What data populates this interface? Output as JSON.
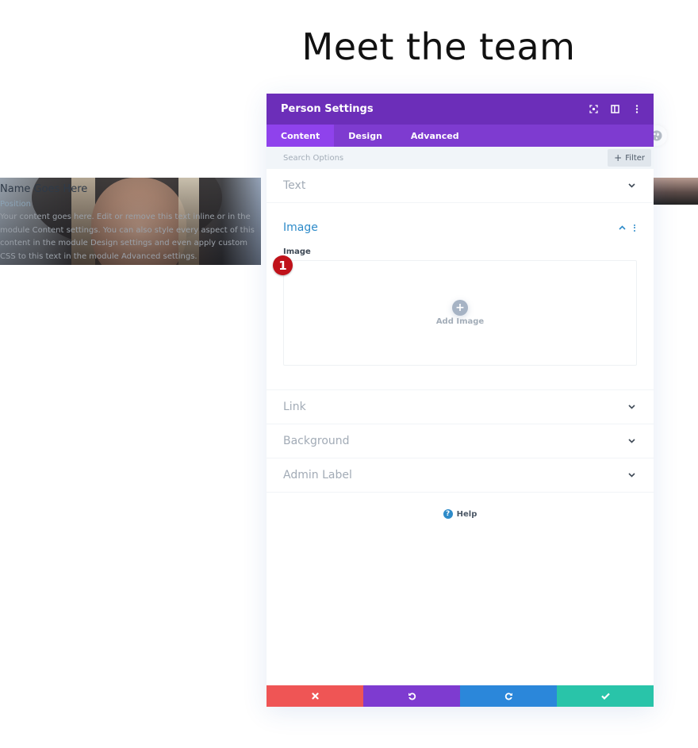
{
  "page": {
    "heading": "Meet the team"
  },
  "person_module": {
    "name": "Name Goes Here",
    "position": "Position",
    "bio": "Your content goes here. Edit or remove this text inline or in the module Content settings. You can also style every aspect of this content in the module Design settings and even apply custom CSS to this text in the module Advanced settings."
  },
  "modal": {
    "title": "Person Settings",
    "header_icons": [
      "focus-icon",
      "split-view-icon",
      "more-options-icon"
    ],
    "tabs": [
      {
        "label": "Content",
        "active": true
      },
      {
        "label": "Design",
        "active": false
      },
      {
        "label": "Advanced",
        "active": false
      }
    ],
    "search": {
      "placeholder": "Search Options",
      "value": ""
    },
    "filter_label": "Filter",
    "sections": [
      {
        "title": "Text",
        "open": false
      },
      {
        "title": "Image",
        "open": true,
        "field_label": "Image",
        "upload_label": "Add Image"
      },
      {
        "title": "Link",
        "open": false
      },
      {
        "title": "Background",
        "open": false
      },
      {
        "title": "Admin Label",
        "open": false
      }
    ],
    "help_label": "Help",
    "footer_buttons": [
      {
        "name": "discard",
        "icon": "close-icon",
        "color": "#ef5555"
      },
      {
        "name": "undo",
        "icon": "undo-icon",
        "color": "#7e3bd0"
      },
      {
        "name": "redo",
        "icon": "redo-icon",
        "color": "#2b87da"
      },
      {
        "name": "save",
        "icon": "check-icon",
        "color": "#29c4a9"
      }
    ]
  },
  "annotation": {
    "step_number": "1",
    "color": "#c0121a"
  },
  "colors": {
    "header_purple": "#6c2eb9",
    "tab_bar_purple": "#7e3bd0",
    "active_tab_purple": "#8f42ec",
    "accent_blue": "#2e8bc9"
  }
}
